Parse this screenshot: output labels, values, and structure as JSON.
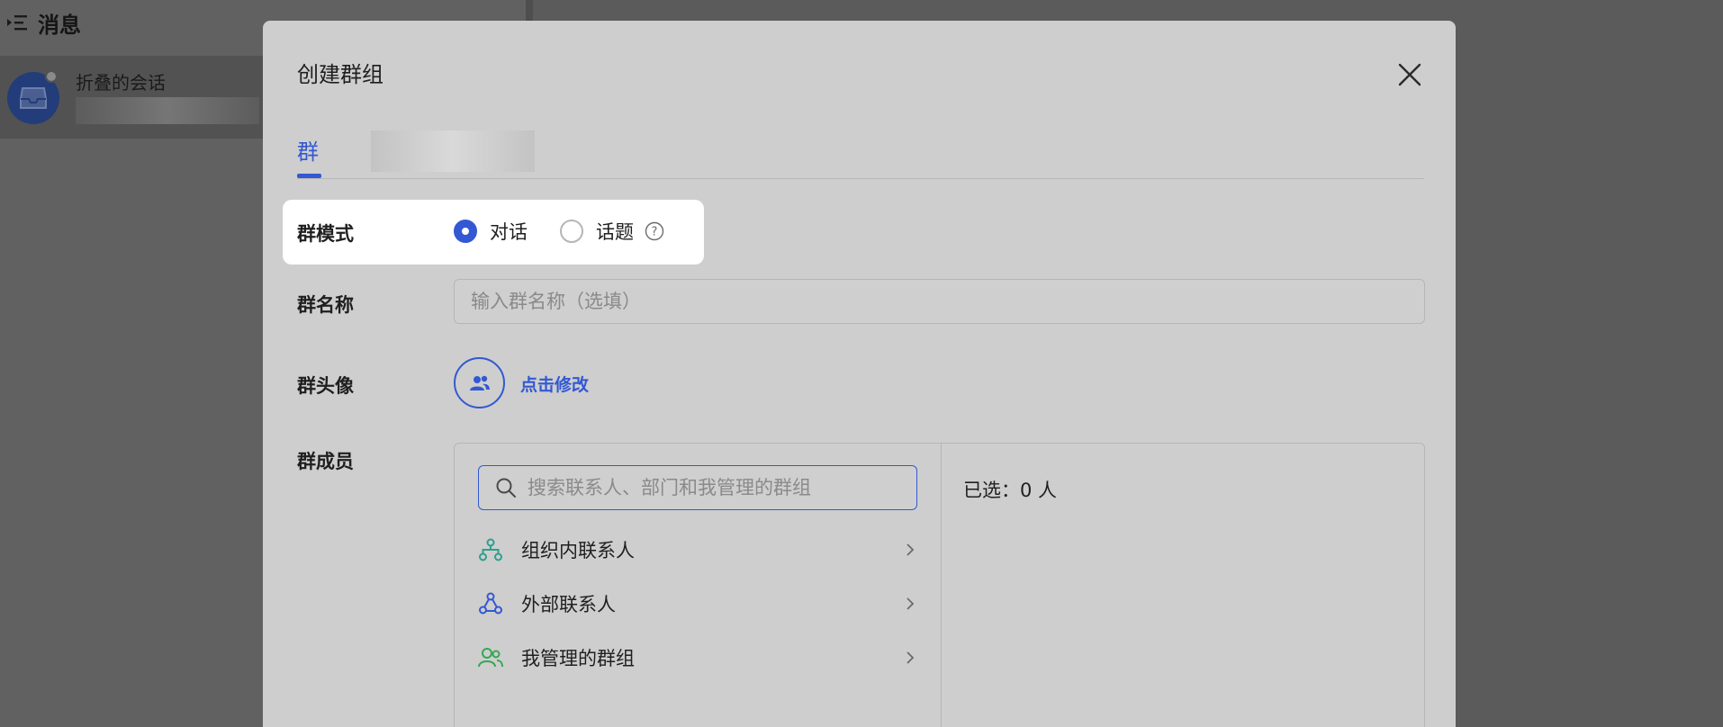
{
  "background": {
    "header_title": "消息",
    "conversation": {
      "title": "折叠的会话"
    }
  },
  "modal": {
    "title": "创建群组",
    "tabs": [
      {
        "label": "群"
      }
    ],
    "mode": {
      "label": "群模式",
      "options": [
        {
          "label": "对话",
          "selected": true
        },
        {
          "label": "话题",
          "selected": false
        }
      ]
    },
    "name": {
      "label": "群名称",
      "placeholder": "输入群名称（选填）",
      "value": ""
    },
    "avatar": {
      "label": "群头像",
      "edit_label": "点击修改"
    },
    "members": {
      "label": "群成员",
      "search_placeholder": "搜索联系人、部门和我管理的群组",
      "items": [
        {
          "label": "组织内联系人",
          "icon": "org-tree-icon",
          "icon_color": "#2f9e8f"
        },
        {
          "label": "外部联系人",
          "icon": "external-contacts-icon",
          "icon_color": "#3358d4"
        },
        {
          "label": "我管理的群组",
          "icon": "managed-groups-icon",
          "icon_color": "#34a853"
        }
      ],
      "selected_text": "已选：0 人"
    }
  },
  "colors": {
    "accent": "#3358d4",
    "overlay": "#5b5b5b",
    "modal_bg": "#cecece",
    "highlight": "#ffffff"
  }
}
